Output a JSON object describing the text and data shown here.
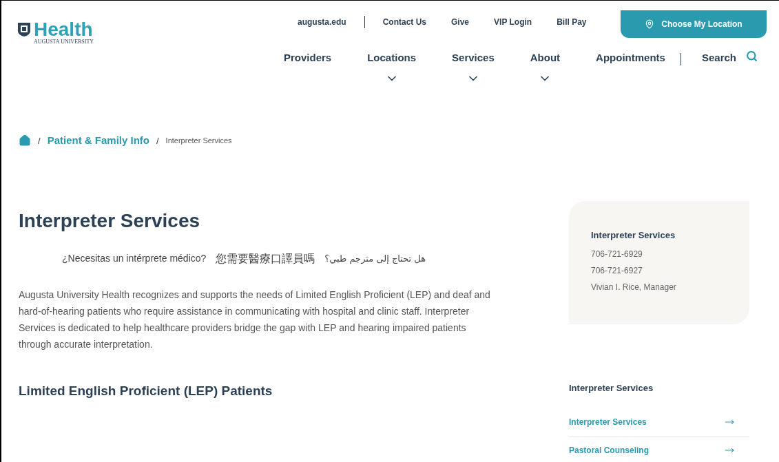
{
  "logo": {
    "word": "Health",
    "subtitle": "AUGUSTA UNIVERSITY"
  },
  "utility_links": [
    {
      "label": "augusta.edu",
      "divider_after": true
    },
    {
      "label": "Contact Us",
      "divider_after": false
    },
    {
      "label": "Give",
      "divider_after": false
    },
    {
      "label": "VIP Login",
      "divider_after": false
    },
    {
      "label": "Bill Pay",
      "divider_after": false
    }
  ],
  "location_button": {
    "label": "Choose My Location"
  },
  "nav": [
    {
      "label": "Providers",
      "has_dropdown": false
    },
    {
      "label": "Locations",
      "has_dropdown": true
    },
    {
      "label": "Services",
      "has_dropdown": true
    },
    {
      "label": "About",
      "has_dropdown": true
    },
    {
      "label": "Appointments",
      "has_dropdown": false
    }
  ],
  "search": {
    "label": "Search"
  },
  "breadcrumb_separator": "/",
  "breadcrumb": [
    {
      "label": "Patient & Family Info",
      "kind": "link"
    },
    {
      "label": "Interpreter Services",
      "kind": "current"
    }
  ],
  "title": "Interpreter Services",
  "languages": [
    {
      "text": "¿Necesitas un intérprete médico?",
      "kind": "latin"
    },
    {
      "text": "您需要醫療口譯員嗎",
      "kind": "cjk"
    },
    {
      "text": "هل تحتاج إلى مترجم طبي؟",
      "kind": "arabic"
    }
  ],
  "intro": "Augusta University Health recognizes and supports the needs of Limited English Proficient (LEP) and deaf and hard-of-hearing patients who require assistance in communicating with hospital and clinic staff. Interpreter Services is dedicated to help healthcare providers bridge the gap with LEP and hearing impaired patients through accurate interpretation.",
  "section_heading": "Limited English Proficient (LEP) Patients",
  "contact_card": {
    "title": "Interpreter Services",
    "lines": [
      "706-721-6929",
      "706-721-6927",
      "Vivian I. Rice, Manager"
    ]
  },
  "side_nav": {
    "title": "Interpreter Services",
    "items": [
      {
        "label": "Interpreter Services"
      },
      {
        "label": "Pastoral Counseling"
      }
    ]
  }
}
